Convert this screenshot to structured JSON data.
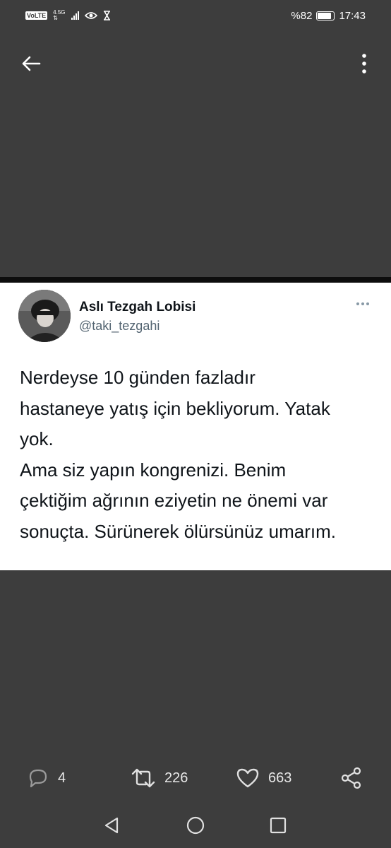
{
  "status_bar": {
    "volte": "VoLTE",
    "network": "4.5G",
    "battery_percent": "%82",
    "time": "17:43",
    "icons": [
      "signal-icon",
      "eye-icon",
      "hourglass-icon",
      "battery-icon"
    ]
  },
  "top_bar": {
    "icons": [
      "back-arrow-icon",
      "more-vertical-icon"
    ]
  },
  "tweet": {
    "author_name": "Aslı Tezgah Lobisi",
    "author_handle": "@taki_tezgahi",
    "text": "Nerdeyse 10 günden fazladır\nhastaneye yatış için bekliyorum. Yatak\nyok.\nAma siz yapın kongrenizi. Benim\nçektiğim ağrının eziyetin ne önemi var\nsonuçta. Sürünerek ölürsünüz umarım."
  },
  "actions": {
    "reply_count": "4",
    "retweet_count": "226",
    "like_count": "663",
    "icons": [
      "reply-icon",
      "retweet-icon",
      "heart-icon",
      "share-icon"
    ]
  },
  "colors": {
    "background": "#3d3d3d",
    "card": "#ffffff",
    "text_primary": "#0f1419",
    "text_secondary": "#536471"
  }
}
